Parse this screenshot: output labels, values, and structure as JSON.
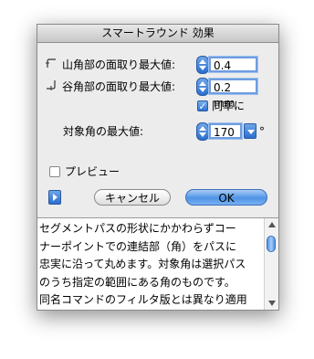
{
  "dialog": {
    "title": "スマートラウンド 効果"
  },
  "peak": {
    "label": "山角部の面取り最大値:",
    "value": "0.4 mm"
  },
  "valley": {
    "label": "谷角部の面取り最大値:",
    "value": "0.2 mm"
  },
  "same_ratio": {
    "label": "同率に",
    "checked": true
  },
  "max_angle": {
    "label": "対象角の最大値:",
    "value": "170",
    "unit": "°"
  },
  "preview": {
    "label": "プレビュー",
    "checked": false
  },
  "buttons": {
    "cancel": "キャンセル",
    "ok": "OK"
  },
  "description": {
    "lines": [
      "セグメントパスの形状にかかわらずコー",
      "ナーポイントでの連結部（角）をパスに",
      "忠実に沿って丸めます。対象角は選択パス",
      "のうち指定の範囲にある角のものです。",
      "同名コマンドのフィルタ版とは異なり適用"
    ]
  }
}
